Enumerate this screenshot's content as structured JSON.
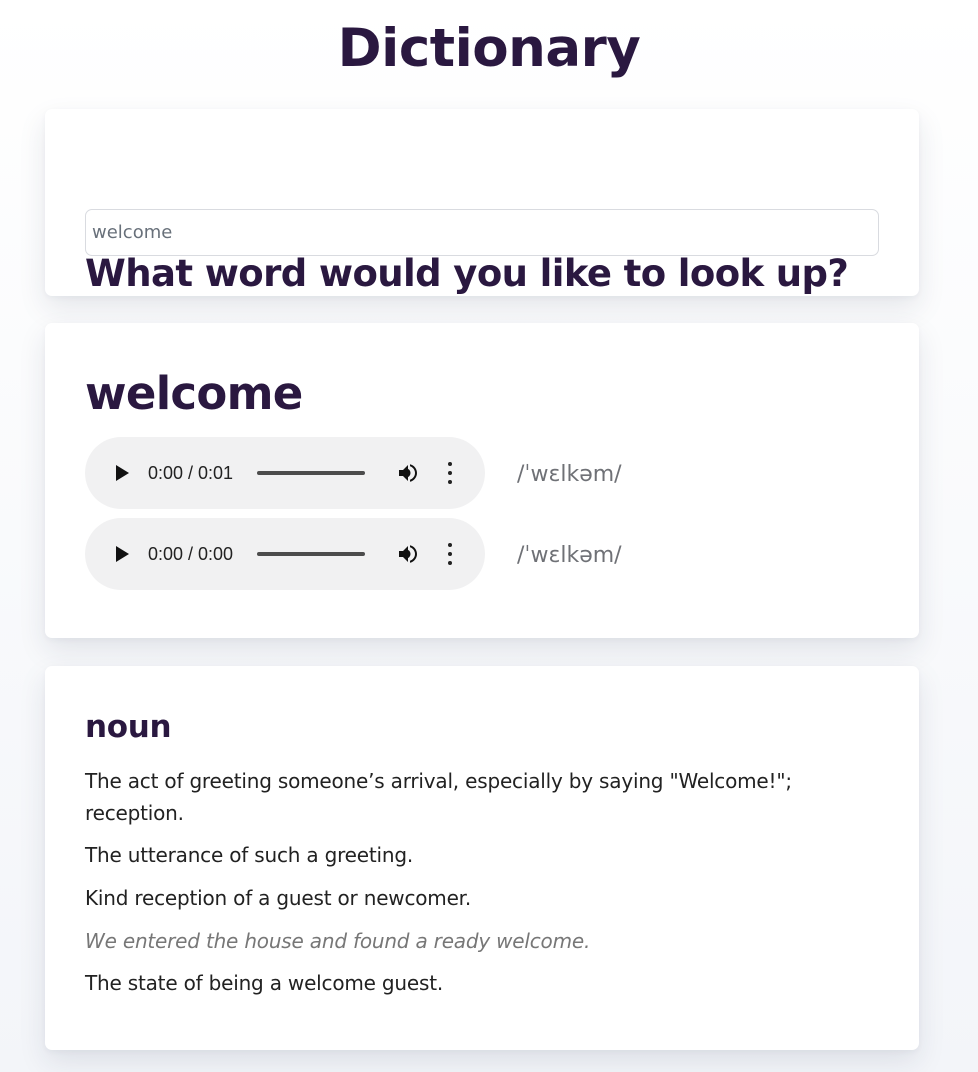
{
  "app": {
    "title": "Dictionary"
  },
  "search": {
    "heading": "What word would you like to look up?",
    "placeholder": "welcome",
    "value": ""
  },
  "result": {
    "word": "welcome",
    "phonetics": [
      {
        "audio_time": "0:00 / 0:01",
        "text": "/ˈwɛlkəm/"
      },
      {
        "audio_time": "0:00 / 0:00",
        "text": "/ˈwɛlkəm/"
      }
    ]
  },
  "meaning": {
    "part_of_speech": "noun",
    "definitions": [
      "The act of greeting someone’s arrival, especially by saying \"Welcome!\"; reception.",
      "The utterance of such a greeting.",
      "Kind reception of a guest or newcomer.",
      "The state of being a welcome guest."
    ],
    "examples": [
      "We entered the house and found a ready welcome."
    ]
  },
  "icons": {
    "play": "play-icon",
    "volume": "volume-icon",
    "more": "more-options-icon"
  }
}
